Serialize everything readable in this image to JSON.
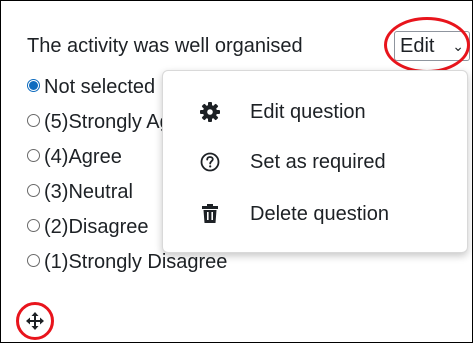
{
  "question": {
    "label": "The activity was well organised",
    "edit_select": {
      "value": "Edit",
      "icon": "chevron-down-icon"
    }
  },
  "options": [
    {
      "label": "Not selected",
      "checked": true
    },
    {
      "label": "(5)Strongly Agree",
      "checked": false
    },
    {
      "label": "(4)Agree",
      "checked": false
    },
    {
      "label": "(3)Neutral",
      "checked": false
    },
    {
      "label": "(2)Disagree",
      "checked": false
    },
    {
      "label": "(1)Strongly Disagree",
      "checked": false
    }
  ],
  "edit_menu": {
    "items": [
      {
        "label": "Edit question",
        "icon": "gear-icon"
      },
      {
        "label": "Set as required",
        "icon": "question-circle-icon"
      },
      {
        "label": "Delete question",
        "icon": "trash-icon"
      }
    ]
  },
  "move_handle": {
    "icon": "move-arrows-icon"
  },
  "colors": {
    "annotation": "#e8141c",
    "radio_accent": "#0f6cbf",
    "text": "#1d2125"
  }
}
